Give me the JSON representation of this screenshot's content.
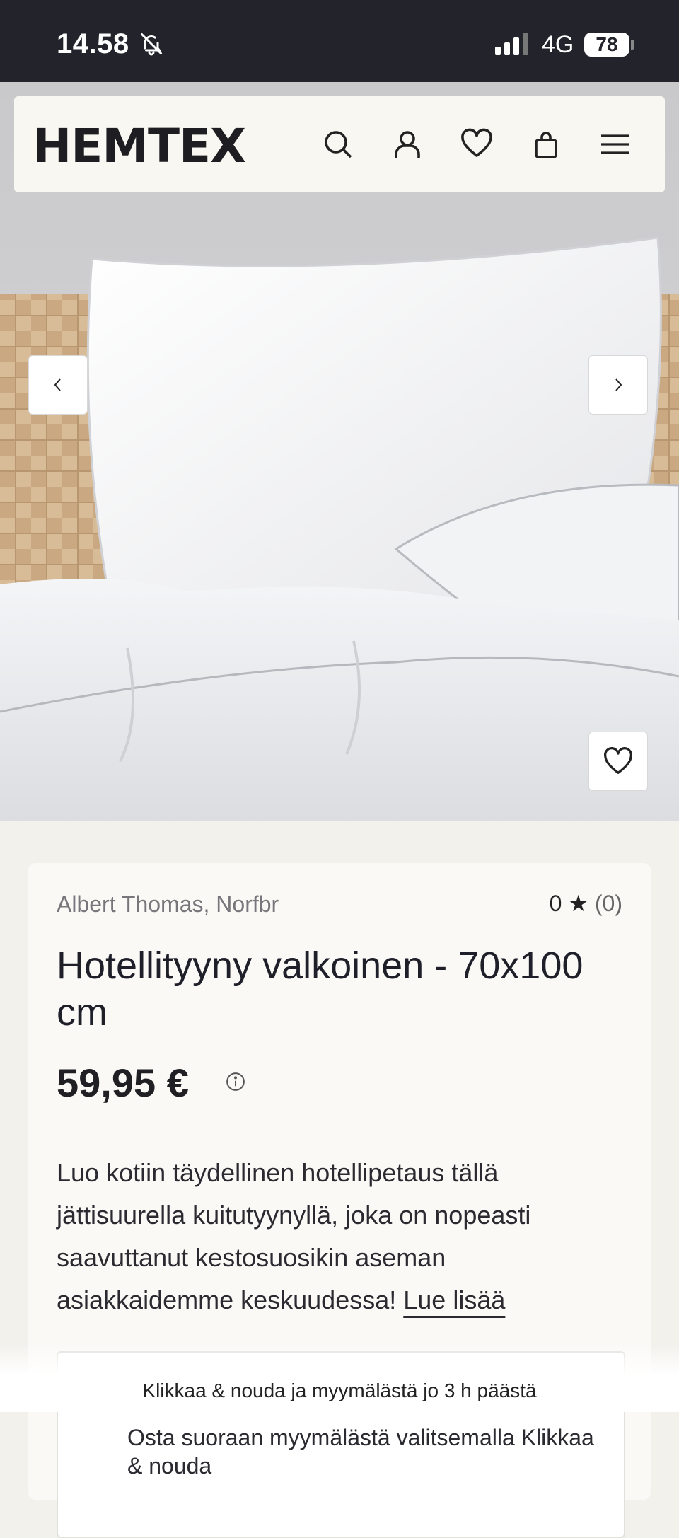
{
  "status_bar": {
    "time": "14.58",
    "network": "4G",
    "battery": "78",
    "icons": [
      "bell-muted-icon",
      "signal-icon"
    ]
  },
  "header": {
    "logo": "HEMTEX",
    "icons": [
      "search-icon",
      "account-icon",
      "heart-icon",
      "bag-icon",
      "menu-icon"
    ]
  },
  "gallery": {
    "prev_icon": "chevron-left-icon",
    "next_icon": "chevron-right-icon",
    "favorite_icon": "heart-icon"
  },
  "product": {
    "brand": "Albert Thomas, Norfbr",
    "rating_value": "0",
    "rating_star": "★",
    "rating_count": "(0)",
    "title": "Hotellityyny valkoinen - 70x100 cm",
    "price": "59,95 €",
    "description": "Luo kotiin täydellinen hotellipetaus tällä jättisuurella kuitutyynyllä, joka on nopeasti saavuttanut kestosuosikin aseman asiakkaidemme keskuudessa! ",
    "read_more": "Lue lisää"
  },
  "store_box": {
    "text": "Osta suoraan myymälästä valitsemalla Klikkaa & nouda"
  },
  "banner": {
    "text": "Klikkaa & nouda ja myymälästä jo 3 h päästä"
  }
}
